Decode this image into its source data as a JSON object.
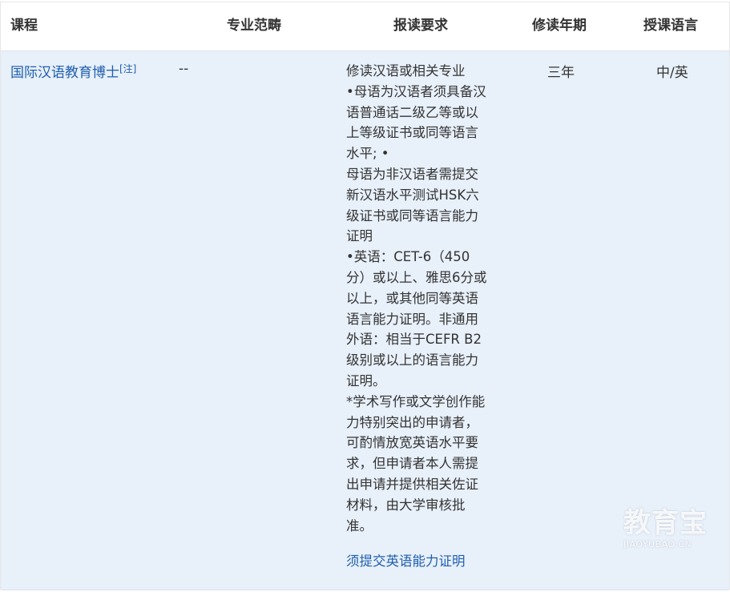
{
  "table": {
    "headers": {
      "course": "课程",
      "specialization": "专业范畴",
      "requirements": "报读要求",
      "duration": "修读年期",
      "language": "授课语言"
    },
    "rows": [
      {
        "course_name": "国际汉语教育博士",
        "course_note": "[注]",
        "specialization": "--",
        "requirement_lines": [
          "修读汉语或相关专业",
          "•母语为汉语者须具备汉",
          "语普通话二级乙等或以",
          "上等级证书或同等语言",
          "水平; •",
          "母语为非汉语者需提交",
          "新汉语水平测试HSK六",
          "级证书或同等语言能力",
          "证明",
          "•英语：CET-6（450",
          "分）或以上、雅思6分或",
          "以上，或其他同等英语",
          "语言能力证明。非通用",
          "外语：相当于CEFR B2",
          "级别或以上的语言能力",
          "证明。",
          "*学术写作或文学创作能",
          "力特别突出的申请者，",
          "可酌情放宽英语水平要",
          "求，但申请者本人需提",
          "出申请并提供相关佐证",
          "材料，由大学审核批",
          "准。"
        ],
        "requirement_link": "须提交英语能力证明",
        "duration": "三年",
        "language": "中/英"
      }
    ]
  },
  "watermark": {
    "main": "教育宝",
    "sub": "JIAOYUBAO.CN"
  }
}
